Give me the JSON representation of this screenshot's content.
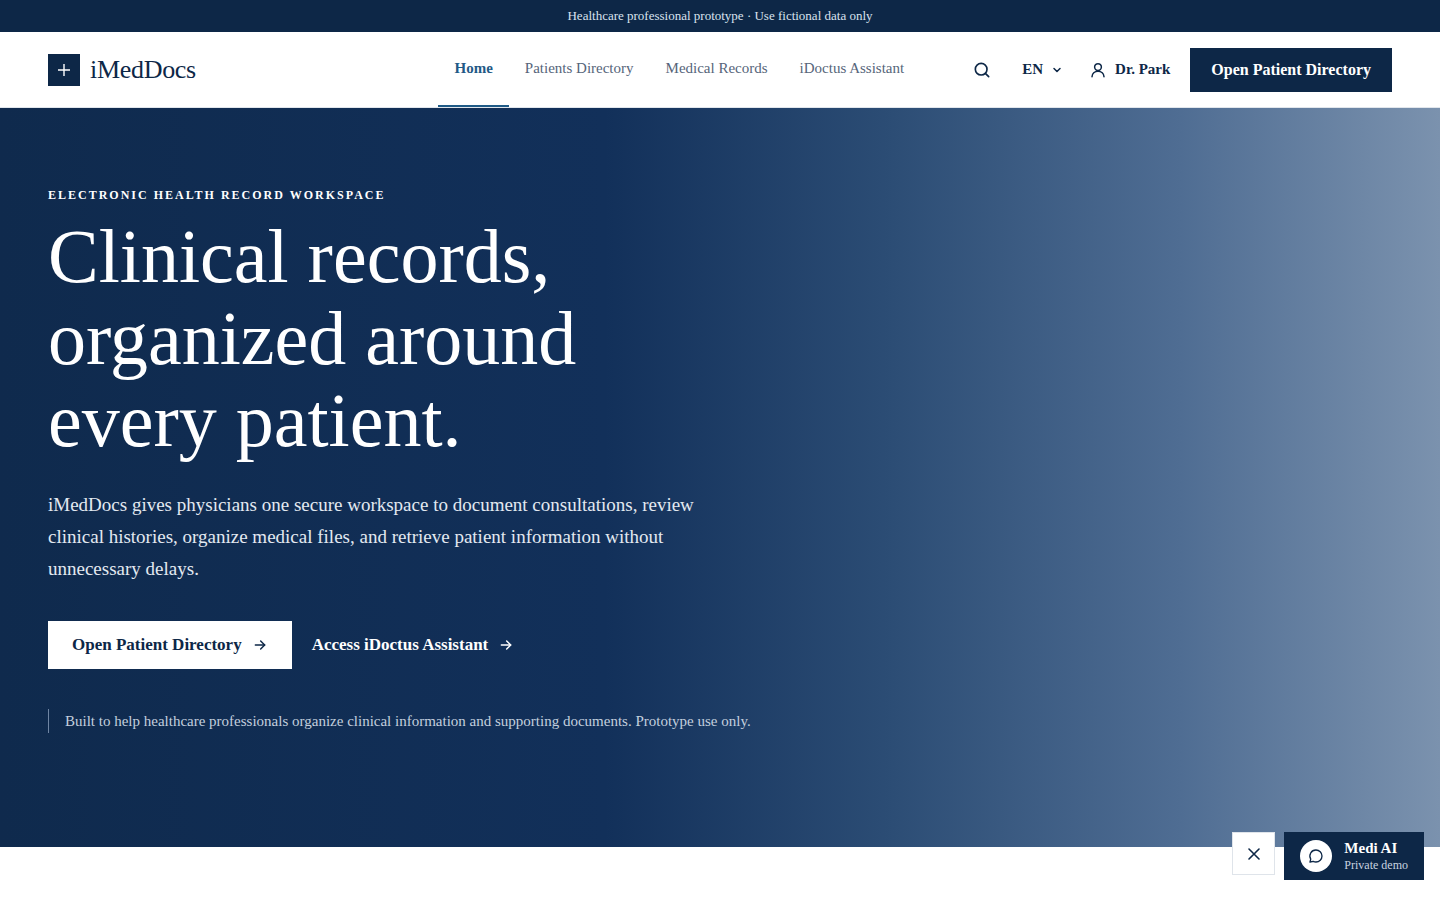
{
  "banner": {
    "text": "Healthcare professional prototype · Use fictional data only"
  },
  "header": {
    "logo": "iMedDocs",
    "nav": [
      {
        "label": "Home",
        "selected": true
      },
      {
        "label": "Patients Directory",
        "selected": false
      },
      {
        "label": "Medical Records",
        "selected": false
      },
      {
        "label": "iDoctus Assistant",
        "selected": false
      }
    ],
    "language": "EN",
    "user": "Dr. Park",
    "cta": "Open Patient Directory"
  },
  "hero": {
    "eyebrow": "ELECTRONIC HEALTH RECORD WORKSPACE",
    "title": "Clinical records, organized around every patient.",
    "description": "iMedDocs gives physicians one secure workspace to document consultations, review clinical histories, organize medical files, and retrieve patient information without unnecessary delays.",
    "primary_action": "Open Patient Directory",
    "secondary_action": "Access iDoctus Assistant",
    "note": "Built to help healthcare professionals organize clinical information and supporting documents. Prototype use only."
  },
  "chat": {
    "title": "Medi AI",
    "subtitle": "Private demo"
  }
}
